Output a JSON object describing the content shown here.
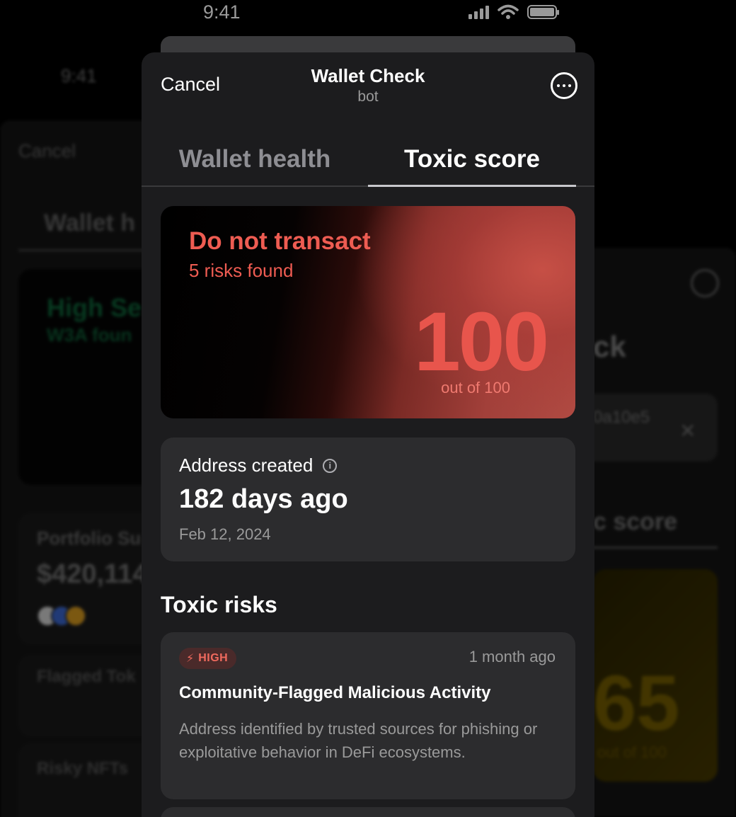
{
  "status": {
    "time": "9:41"
  },
  "background": {
    "left_phone": {
      "time": "9:41",
      "cancel": "Cancel",
      "tab": "Wallet h",
      "status_title": "High Se",
      "status_sub": "W3A foun",
      "portfolio_title": "Portfolio Su",
      "portfolio_value": "$420,114",
      "flagged_title": "Flagged Tok",
      "risky_title": "Risky NFTs"
    },
    "right_phone": {
      "title": "ck",
      "address": "0a10e5",
      "tab": "c score",
      "score": "65",
      "score_out": "out of 100"
    }
  },
  "header": {
    "cancel_label": "Cancel",
    "title": "Wallet Check",
    "subtitle": "bot"
  },
  "tabs": [
    {
      "label": "Wallet health",
      "active": false
    },
    {
      "label": "Toxic score",
      "active": true
    }
  ],
  "score_card": {
    "title": "Do not transact",
    "subtitle": "5 risks found",
    "score": "100",
    "score_out": "out of 100",
    "accent": "#e8554c"
  },
  "address_created": {
    "label": "Address created",
    "value": "182 days ago",
    "date": "Feb 12, 2024"
  },
  "toxic_risks": {
    "title": "Toxic risks",
    "items": [
      {
        "severity": "HIGH",
        "time": "1 month ago",
        "name": "Community-Flagged Malicious Activity",
        "description": "Address identified by trusted sources for phishing or exploitative behavior in DeFi ecosystems."
      }
    ]
  },
  "icons": [
    "more-icon",
    "info-icon",
    "lightning-icon",
    "signal-icon",
    "wifi-icon",
    "battery-icon"
  ]
}
